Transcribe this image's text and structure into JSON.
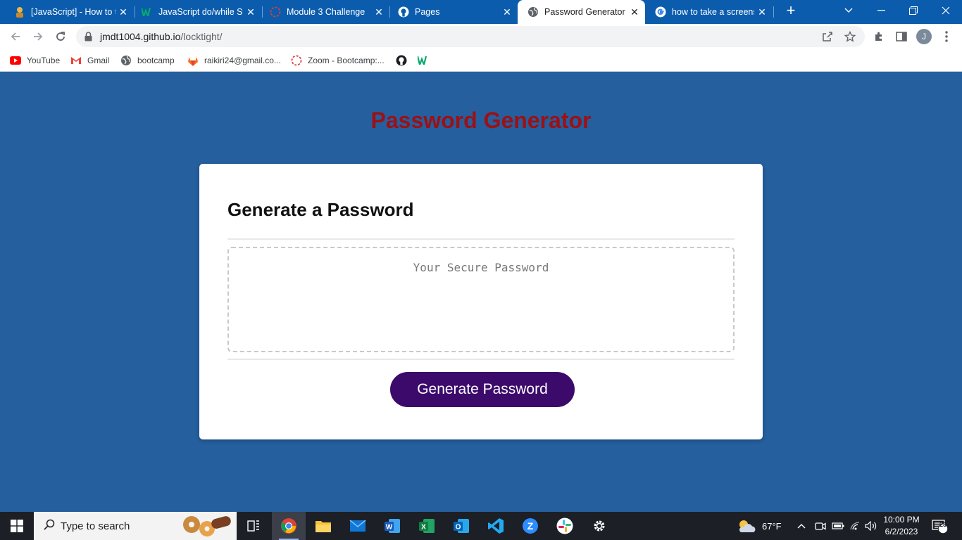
{
  "browser": {
    "tabs": [
      {
        "title": "[JavaScript] - How to t",
        "close": "✕"
      },
      {
        "title": "JavaScript do/while St",
        "close": "✕"
      },
      {
        "title": "Module 3 Challenge",
        "close": "✕"
      },
      {
        "title": "Pages",
        "close": "✕"
      },
      {
        "title": "Password Generator",
        "close": "✕"
      },
      {
        "title": "how to take a screensh",
        "close": "✕"
      }
    ],
    "new_tab": "+",
    "url_host": "jmdt1004.github.io",
    "url_path": "/locktight/",
    "profile_initial": "J",
    "bookmarks": [
      "YouTube",
      "Gmail",
      "bootcamp",
      "raikiri24@gmail.co...",
      "Zoom - Bootcamp:..."
    ]
  },
  "page": {
    "title": "Password Generator",
    "card_header": "Generate a Password",
    "password_placeholder": "Your Secure Password",
    "generate_button": "Generate Password"
  },
  "taskbar": {
    "search_placeholder": "Type to search",
    "weather": "67°F",
    "time": "10:00 PM",
    "date": "6/2/2023",
    "notifications": "23"
  },
  "colors": {
    "page_background": "#255f9e",
    "title_red": "#9b1116",
    "button_purple": "#3b0a6b",
    "tabstrip_blue": "#0b5cad"
  }
}
